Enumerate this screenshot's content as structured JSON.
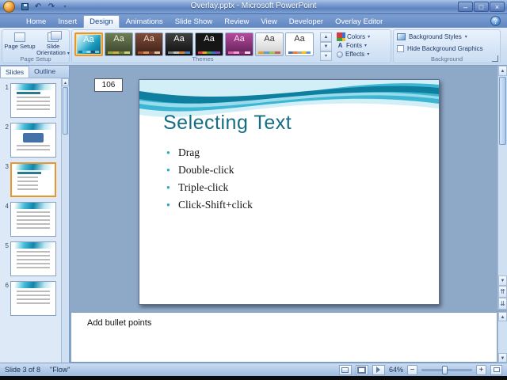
{
  "window": {
    "title": "Overlay.pptx - Microsoft PowerPoint"
  },
  "icons": {
    "dropdown": "▾",
    "up": "▲",
    "down": "▼",
    "undo": "↶",
    "redo": "↷",
    "minus": "−",
    "plus": "+",
    "prev_slide": "⇈",
    "next_slide": "⇊",
    "minimize": "–",
    "maximize": "□",
    "close": "×",
    "help": "?"
  },
  "ribbon": {
    "tabs": [
      {
        "label": "Home"
      },
      {
        "label": "Insert"
      },
      {
        "label": "Design"
      },
      {
        "label": "Animations"
      },
      {
        "label": "Slide Show"
      },
      {
        "label": "Review"
      },
      {
        "label": "View"
      },
      {
        "label": "Developer"
      },
      {
        "label": "Overlay Editor"
      }
    ],
    "active_tab": "Design",
    "page_setup": {
      "group_label": "Page Setup",
      "page_setup_button": "Page Setup",
      "orientation_button": "Slide Orientation"
    },
    "themes": {
      "group_label": "Themes",
      "thumb_label": "Aa",
      "colors_button": "Colors",
      "fonts_button": "Fonts",
      "effects_button": "Effects"
    },
    "background": {
      "group_label": "Background",
      "styles_button": "Background Styles",
      "hide_graphics_label": "Hide Background Graphics",
      "hide_graphics_checked": false
    }
  },
  "slides_pane": {
    "tabs": [
      {
        "label": "Slides"
      },
      {
        "label": "Outline"
      }
    ],
    "active_tab": "Slides",
    "thumbnails": [
      {
        "number": "1"
      },
      {
        "number": "2"
      },
      {
        "number": "3",
        "selected": true
      },
      {
        "number": "4"
      },
      {
        "number": "5"
      },
      {
        "number": "6"
      }
    ]
  },
  "canvas": {
    "page_label": "106",
    "slide": {
      "title": "Selecting Text",
      "bullets": [
        "Drag",
        "Double-click",
        "Triple-click",
        "Click-Shift+click"
      ]
    }
  },
  "notes": {
    "text": "Add bullet points"
  },
  "status_bar": {
    "slide_indicator": "Slide 3 of 8",
    "theme_name": "\"Flow\"",
    "zoom_level": "64%"
  },
  "colors": {
    "title_teal": "#156e83",
    "bullet_teal": "#2aa8c8",
    "selection_orange": "#e8962e",
    "titlebar_blue": "#6288c2"
  }
}
